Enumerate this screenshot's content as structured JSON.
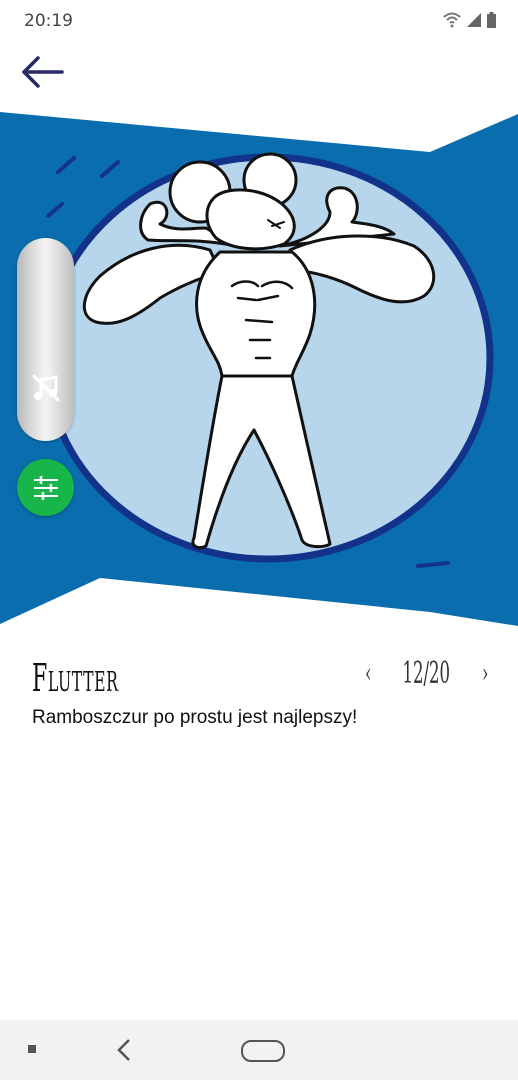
{
  "status": {
    "time": "20:19"
  },
  "icons": {
    "wifi": "wifi-icon",
    "signal": "signal-icon",
    "battery": "battery-icon",
    "back": "arrow-left-icon",
    "mute": "music-off-icon",
    "filter": "sliders-icon"
  },
  "card": {
    "word": "Flutter",
    "pager": {
      "prev": "‹",
      "count": "12/20",
      "next": "›"
    },
    "sentence": "Ramboszczur po prostu jest najlepszy!"
  },
  "colors": {
    "banner_blue": "#0a6eae",
    "circle_light": "#b7d6ec",
    "circle_border": "#13338a",
    "green_button": "#17b54a",
    "back_arrow": "#2a2a66"
  }
}
